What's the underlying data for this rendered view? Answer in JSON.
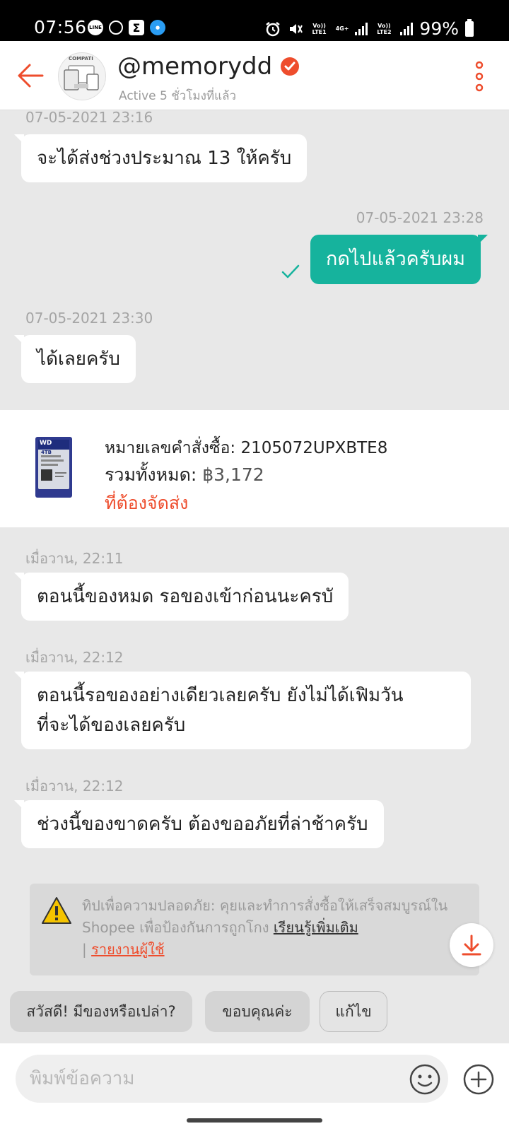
{
  "status_bar": {
    "time": "07:56",
    "left_icons": [
      "line-icon",
      "location-icon",
      "sigma-icon",
      "app-icon"
    ],
    "line_text": "LINE",
    "sigma_glyph": "Σ",
    "sim1_label": "Vo)) LTE1",
    "network_label": "4G+",
    "sim2_label": "Vo)) LTE2",
    "battery": "99%"
  },
  "header": {
    "shop_name": "@memorydd",
    "avatar_text": "COMPATI",
    "active_status": "Active 5 ชั่วโมงที่แล้ว",
    "accent_color": "#ee4d2d"
  },
  "messages": [
    {
      "timestamp": "07-05-2021 23:16",
      "text": "จะได้ส่งช่วงประมาณ 13 ให้ครับ",
      "direction": "in"
    },
    {
      "timestamp": "07-05-2021 23:28",
      "text": "กดไปแล้วครับผม",
      "direction": "out",
      "status": "sent"
    },
    {
      "timestamp": "07-05-2021 23:30",
      "text": "ได้เลยครับ",
      "direction": "in"
    }
  ],
  "order": {
    "order_number": "หมายเลขคำสั่งซื้อ: 2105072UPXBTE8",
    "total_label": "รวมทั้งหมด:",
    "total_amount": "฿3,172",
    "status": "ที่ต้องจัดส่ง",
    "thumb_brand": "WD",
    "thumb_capacity": "4TB"
  },
  "messages_2": [
    {
      "timestamp": "เมื่อวาน, 22:11",
      "text": "ตอนนี้ของหมด รอของเข้าก่อนนะครบั"
    },
    {
      "timestamp": "เมื่อวาน, 22:12",
      "line1": "ตอนนี้รอของอย่างเดียวเลยครับ ยังไม่ได้เฟิมวัน",
      "line2": "ที่จะได้ของเลยครับ"
    },
    {
      "timestamp": "เมื่อวาน, 22:12",
      "text": "ช่วงนี้ของขาดครับ ต้องขออภัยที่ล่าช้าครับ"
    }
  ],
  "safety_tip": {
    "text": "ทิปเพื่อความปลอดภัย: คุยและทำการสั่งซื้อให้เสร็จสมบูรณ์ใน Shopee เพื่อป้องกันการถูกโกง",
    "learn_more": "เรียนรู้เพิ่มเติม",
    "separator": "|",
    "report": "รายงานผู้ใช้"
  },
  "quick_replies": [
    "สวัสดี! มีของหรือเปล่า?",
    "ขอบคุณค่ะ",
    "แก้ไข"
  ],
  "input": {
    "placeholder": "พิมพ์ข้อความ"
  },
  "colors": {
    "outgoing_bubble": "#16b39d",
    "chat_background": "#e8e8e8"
  }
}
